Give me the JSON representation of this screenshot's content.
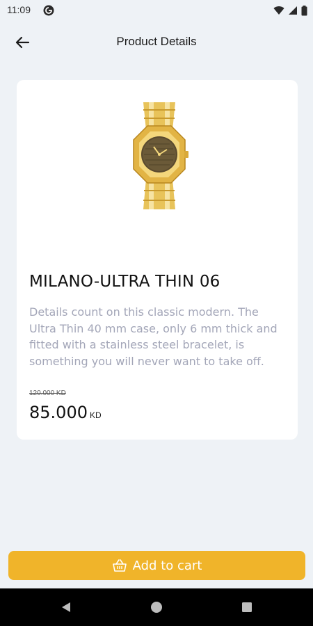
{
  "status_bar": {
    "time": "11:09",
    "icons": [
      "g-badge-icon",
      "wifi-icon",
      "signal-icon",
      "battery-icon"
    ]
  },
  "header": {
    "title": "Product Details",
    "back_icon": "arrow-left-icon"
  },
  "product": {
    "name": "MILANO-ULTRA THIN 06",
    "description": "Details count on this classic modern. The Ultra Thin 40 mm case, only 6 mm thick and fitted with a stainless steel bracelet, is something you will never want to take off.",
    "old_price": "120.000 KD",
    "price": "85.000",
    "currency": "KD",
    "image_icon": "gold-watch-image"
  },
  "actions": {
    "add_to_cart_label": "Add to cart",
    "add_to_cart_icon": "basket-icon"
  },
  "system_nav": {
    "icons": [
      "back-triangle-icon",
      "home-circle-icon",
      "recents-square-icon"
    ]
  },
  "colors": {
    "background": "#eef2f6",
    "accent": "#f0b42a",
    "description_text": "#a3a6b8"
  }
}
